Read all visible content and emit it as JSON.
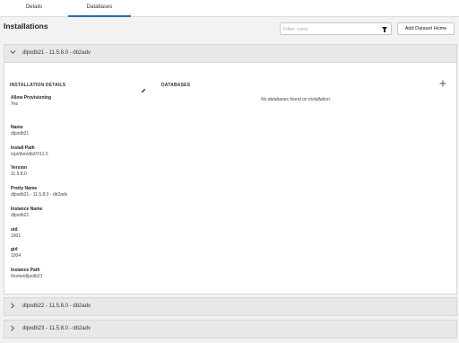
{
  "tabs": [
    {
      "label": "Details"
    },
    {
      "label": "Databases"
    }
  ],
  "header": {
    "title": "Installations",
    "filter_placeholder": "Filter: none",
    "add_button": "Add Dataset Home"
  },
  "installations": [
    {
      "label": "dlpxdb21 - 11.5.8.0 - db2adv",
      "expanded": true
    },
    {
      "label": "dlpxdb22 - 11.5.8.0 - db2adv",
      "expanded": false
    },
    {
      "label": "dlpxdb23 - 11.5.8.0 - db2adv",
      "expanded": false
    }
  ],
  "details": {
    "section_title": "INSTALLATION DETAILS",
    "fields": [
      {
        "key": "Allow Provisioning",
        "value": "Yes"
      },
      {
        "key": "Name",
        "value": "dlpxdb21"
      },
      {
        "key": "Install Path",
        "value": "/opt/ibm/db2/V11.5"
      },
      {
        "key": "Version",
        "value": "11.5.8.0"
      },
      {
        "key": "Pretty Name",
        "value": "dlpxdb21 - 11.5.8.0 - db2adv"
      },
      {
        "key": "Instance Name",
        "value": "dlpxdb21"
      },
      {
        "key": "uid",
        "value": "1001"
      },
      {
        "key": "gid",
        "value": "1004"
      },
      {
        "key": "Instance Path",
        "value": "/home/dlpxdb21"
      }
    ]
  },
  "databases": {
    "section_title": "DATABASES",
    "empty_message": "No databases found on installation."
  },
  "icons": {
    "expanded_chevron": "chevron-down-icon",
    "collapsed_chevron": "chevron-right-icon",
    "edit": "pencil-icon",
    "add": "plus-icon",
    "filter": "funnel-icon"
  },
  "colors": {
    "active_tab_underline": "#1f6fb5",
    "panel_header_bg": "#e8e8e8",
    "page_bg": "#f2f2f2"
  }
}
